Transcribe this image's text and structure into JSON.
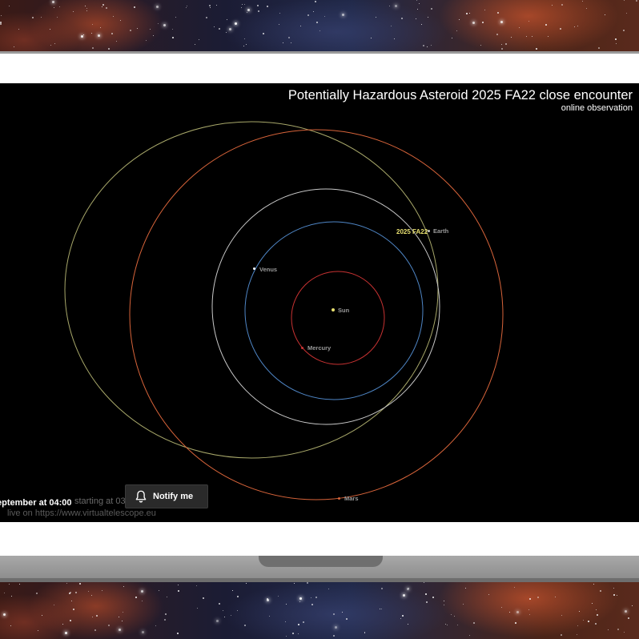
{
  "video": {
    "title": "Potentially Hazardous Asteroid 2025 FA22 close encounter",
    "subtitle": "online observation",
    "bodies": {
      "sun": "Sun",
      "mercury": "Mercury",
      "venus": "Venus",
      "earth": "Earth",
      "mars": "Mars",
      "asteroid": "2025 FA22"
    },
    "schedule_text": "eptember at 04:00",
    "faded_starting_text": "starting at 03:",
    "faded_live_text": "live on https://www.virtualtelescope.eu",
    "notify_label": "Notify me"
  },
  "colors": {
    "mercury_orbit": "#c83232",
    "venus_orbit": "#4f86c6",
    "earth_orbit": "#c8c8c8",
    "mars_orbit": "#d8643a",
    "asteroid_orbit": "#a8a86a",
    "asteroid_label": "#e8e070"
  },
  "icons": {
    "notify": "bell-icon"
  }
}
